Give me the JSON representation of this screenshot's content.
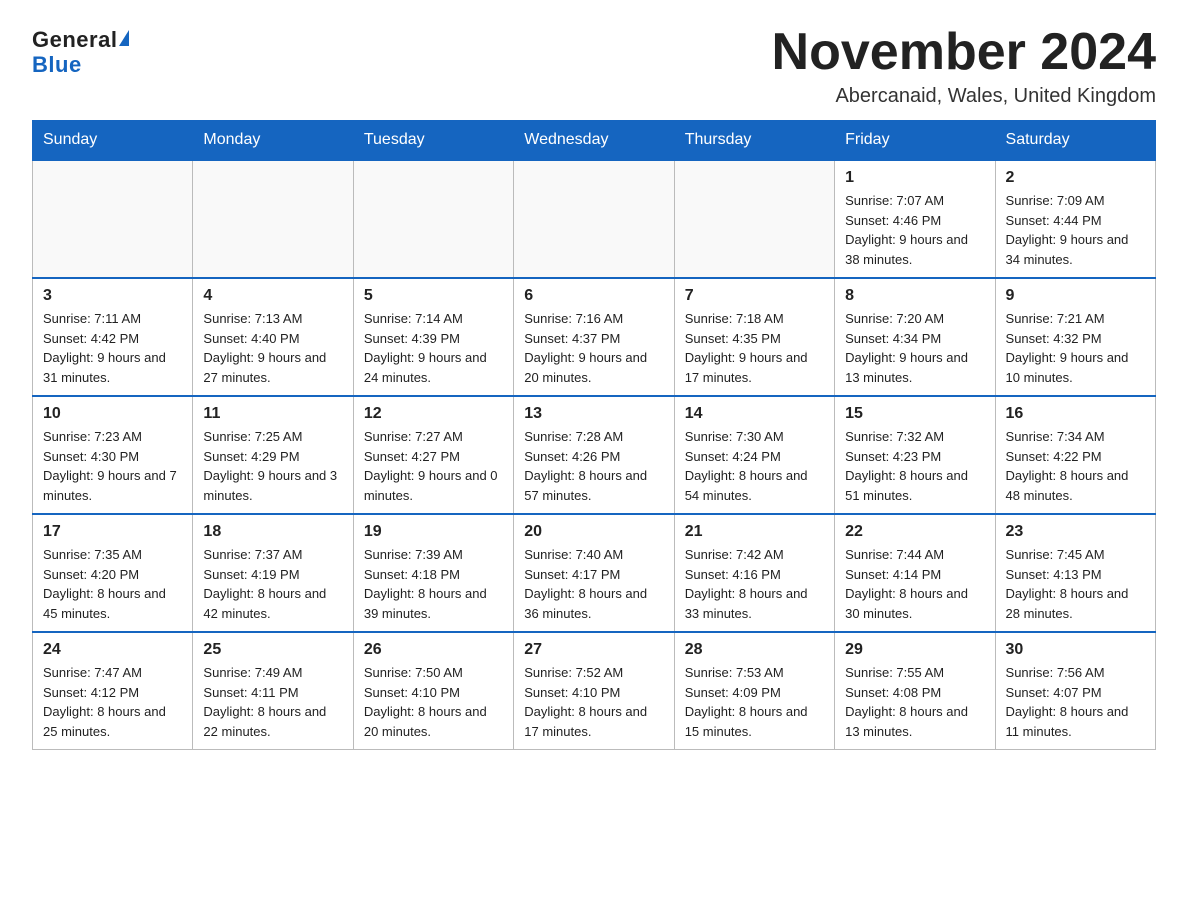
{
  "logo": {
    "general": "General",
    "blue": "Blue"
  },
  "title": "November 2024",
  "location": "Abercanaid, Wales, United Kingdom",
  "days_of_week": [
    "Sunday",
    "Monday",
    "Tuesday",
    "Wednesday",
    "Thursday",
    "Friday",
    "Saturday"
  ],
  "weeks": [
    [
      {
        "day": "",
        "info": ""
      },
      {
        "day": "",
        "info": ""
      },
      {
        "day": "",
        "info": ""
      },
      {
        "day": "",
        "info": ""
      },
      {
        "day": "",
        "info": ""
      },
      {
        "day": "1",
        "info": "Sunrise: 7:07 AM\nSunset: 4:46 PM\nDaylight: 9 hours and 38 minutes."
      },
      {
        "day": "2",
        "info": "Sunrise: 7:09 AM\nSunset: 4:44 PM\nDaylight: 9 hours and 34 minutes."
      }
    ],
    [
      {
        "day": "3",
        "info": "Sunrise: 7:11 AM\nSunset: 4:42 PM\nDaylight: 9 hours and 31 minutes."
      },
      {
        "day": "4",
        "info": "Sunrise: 7:13 AM\nSunset: 4:40 PM\nDaylight: 9 hours and 27 minutes."
      },
      {
        "day": "5",
        "info": "Sunrise: 7:14 AM\nSunset: 4:39 PM\nDaylight: 9 hours and 24 minutes."
      },
      {
        "day": "6",
        "info": "Sunrise: 7:16 AM\nSunset: 4:37 PM\nDaylight: 9 hours and 20 minutes."
      },
      {
        "day": "7",
        "info": "Sunrise: 7:18 AM\nSunset: 4:35 PM\nDaylight: 9 hours and 17 minutes."
      },
      {
        "day": "8",
        "info": "Sunrise: 7:20 AM\nSunset: 4:34 PM\nDaylight: 9 hours and 13 minutes."
      },
      {
        "day": "9",
        "info": "Sunrise: 7:21 AM\nSunset: 4:32 PM\nDaylight: 9 hours and 10 minutes."
      }
    ],
    [
      {
        "day": "10",
        "info": "Sunrise: 7:23 AM\nSunset: 4:30 PM\nDaylight: 9 hours and 7 minutes."
      },
      {
        "day": "11",
        "info": "Sunrise: 7:25 AM\nSunset: 4:29 PM\nDaylight: 9 hours and 3 minutes."
      },
      {
        "day": "12",
        "info": "Sunrise: 7:27 AM\nSunset: 4:27 PM\nDaylight: 9 hours and 0 minutes."
      },
      {
        "day": "13",
        "info": "Sunrise: 7:28 AM\nSunset: 4:26 PM\nDaylight: 8 hours and 57 minutes."
      },
      {
        "day": "14",
        "info": "Sunrise: 7:30 AM\nSunset: 4:24 PM\nDaylight: 8 hours and 54 minutes."
      },
      {
        "day": "15",
        "info": "Sunrise: 7:32 AM\nSunset: 4:23 PM\nDaylight: 8 hours and 51 minutes."
      },
      {
        "day": "16",
        "info": "Sunrise: 7:34 AM\nSunset: 4:22 PM\nDaylight: 8 hours and 48 minutes."
      }
    ],
    [
      {
        "day": "17",
        "info": "Sunrise: 7:35 AM\nSunset: 4:20 PM\nDaylight: 8 hours and 45 minutes."
      },
      {
        "day": "18",
        "info": "Sunrise: 7:37 AM\nSunset: 4:19 PM\nDaylight: 8 hours and 42 minutes."
      },
      {
        "day": "19",
        "info": "Sunrise: 7:39 AM\nSunset: 4:18 PM\nDaylight: 8 hours and 39 minutes."
      },
      {
        "day": "20",
        "info": "Sunrise: 7:40 AM\nSunset: 4:17 PM\nDaylight: 8 hours and 36 minutes."
      },
      {
        "day": "21",
        "info": "Sunrise: 7:42 AM\nSunset: 4:16 PM\nDaylight: 8 hours and 33 minutes."
      },
      {
        "day": "22",
        "info": "Sunrise: 7:44 AM\nSunset: 4:14 PM\nDaylight: 8 hours and 30 minutes."
      },
      {
        "day": "23",
        "info": "Sunrise: 7:45 AM\nSunset: 4:13 PM\nDaylight: 8 hours and 28 minutes."
      }
    ],
    [
      {
        "day": "24",
        "info": "Sunrise: 7:47 AM\nSunset: 4:12 PM\nDaylight: 8 hours and 25 minutes."
      },
      {
        "day": "25",
        "info": "Sunrise: 7:49 AM\nSunset: 4:11 PM\nDaylight: 8 hours and 22 minutes."
      },
      {
        "day": "26",
        "info": "Sunrise: 7:50 AM\nSunset: 4:10 PM\nDaylight: 8 hours and 20 minutes."
      },
      {
        "day": "27",
        "info": "Sunrise: 7:52 AM\nSunset: 4:10 PM\nDaylight: 8 hours and 17 minutes."
      },
      {
        "day": "28",
        "info": "Sunrise: 7:53 AM\nSunset: 4:09 PM\nDaylight: 8 hours and 15 minutes."
      },
      {
        "day": "29",
        "info": "Sunrise: 7:55 AM\nSunset: 4:08 PM\nDaylight: 8 hours and 13 minutes."
      },
      {
        "day": "30",
        "info": "Sunrise: 7:56 AM\nSunset: 4:07 PM\nDaylight: 8 hours and 11 minutes."
      }
    ]
  ]
}
